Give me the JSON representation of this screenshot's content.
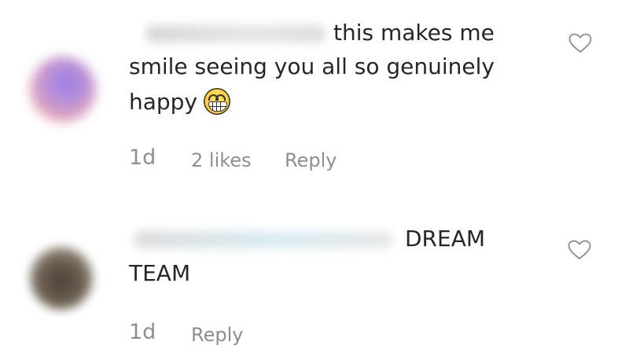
{
  "comments": [
    {
      "text_line1": "this makes me",
      "text_line2": "smile seeing you all so genuinely",
      "text_line3": "happy",
      "emoji": "grinning-face-with-teeth-icon",
      "time": "1d",
      "likes": "2 likes",
      "reply_label": "Reply",
      "like_icon": "heart-outline-icon"
    },
    {
      "text_line1": "DREAM",
      "text_line2": "TEAM",
      "time": "1d",
      "reply_label": "Reply",
      "like_icon": "heart-outline-icon"
    }
  ],
  "colors": {
    "text": "#262626",
    "meta": "#8e8e8e",
    "icon": "#8e8e8e"
  }
}
